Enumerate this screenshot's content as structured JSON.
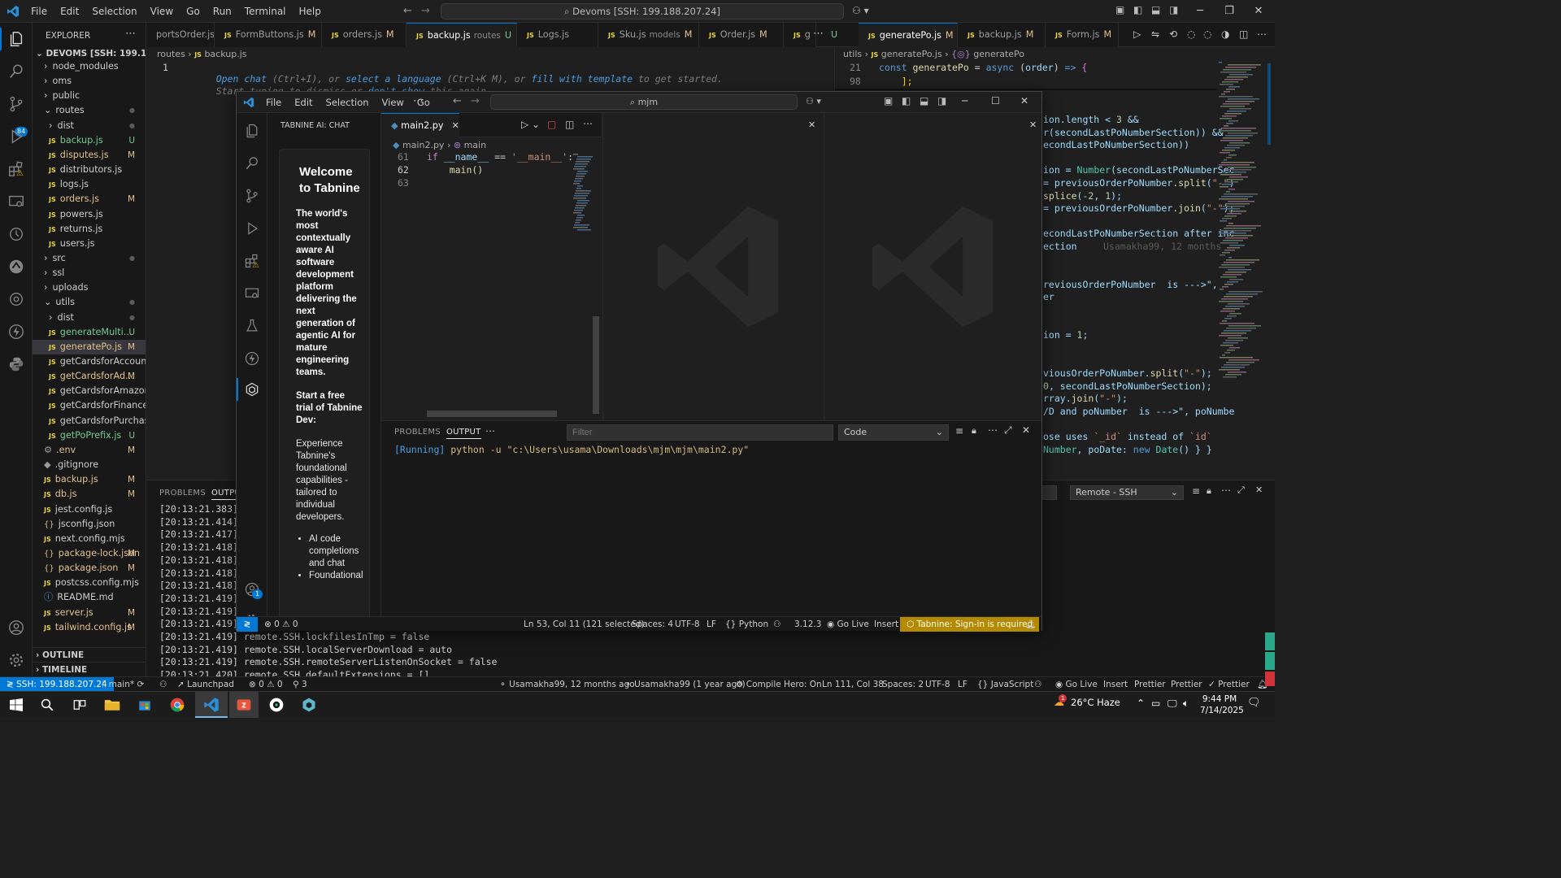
{
  "menu": [
    "File",
    "Edit",
    "Selection",
    "View",
    "Go",
    "Run",
    "Terminal",
    "Help"
  ],
  "command_center": "Devoms [SSH: 199.188.207.24]",
  "explorer": {
    "title": "EXPLORER",
    "root": "DEVOMS [SSH: 199.188.20...",
    "items": [
      {
        "name": "node_modules",
        "kind": "folder-closed",
        "depth": 1,
        "status": ""
      },
      {
        "name": "oms",
        "kind": "folder-closed",
        "depth": 1,
        "status": ""
      },
      {
        "name": "public",
        "kind": "folder-closed",
        "depth": 1,
        "status": ""
      },
      {
        "name": "routes",
        "kind": "folder-open",
        "depth": 1,
        "status": "dot"
      },
      {
        "name": "dist",
        "kind": "folder-closed",
        "depth": 2,
        "status": "dot"
      },
      {
        "name": "backup.js",
        "kind": "js",
        "depth": 2,
        "status": "U"
      },
      {
        "name": "disputes.js",
        "kind": "js",
        "depth": 2,
        "status": "M"
      },
      {
        "name": "distributors.js",
        "kind": "js",
        "depth": 2,
        "status": ""
      },
      {
        "name": "logs.js",
        "kind": "js",
        "depth": 2,
        "status": ""
      },
      {
        "name": "orders.js",
        "kind": "js",
        "depth": 2,
        "status": "M"
      },
      {
        "name": "powers.js",
        "kind": "js",
        "depth": 2,
        "status": ""
      },
      {
        "name": "returns.js",
        "kind": "js",
        "depth": 2,
        "status": ""
      },
      {
        "name": "users.js",
        "kind": "js",
        "depth": 2,
        "status": ""
      },
      {
        "name": "src",
        "kind": "folder-closed",
        "depth": 1,
        "status": "dot"
      },
      {
        "name": "ssl",
        "kind": "folder-closed",
        "depth": 1,
        "status": ""
      },
      {
        "name": "uploads",
        "kind": "folder-closed",
        "depth": 1,
        "status": ""
      },
      {
        "name": "utils",
        "kind": "folder-open",
        "depth": 1,
        "status": "dot"
      },
      {
        "name": "dist",
        "kind": "folder-closed",
        "depth": 2,
        "status": "dot"
      },
      {
        "name": "generateMulti...",
        "kind": "js",
        "depth": 2,
        "status": "U"
      },
      {
        "name": "generatePo.js",
        "kind": "js",
        "depth": 2,
        "status": "M",
        "selected": true
      },
      {
        "name": "getCardsforAccount.js",
        "kind": "js",
        "depth": 2,
        "status": ""
      },
      {
        "name": "getCardsforAd...",
        "kind": "js",
        "depth": 2,
        "status": "M"
      },
      {
        "name": "getCardsforAmazon.js",
        "kind": "js",
        "depth": 2,
        "status": ""
      },
      {
        "name": "getCardsforFinance.js",
        "kind": "js",
        "depth": 2,
        "status": ""
      },
      {
        "name": "getCardsforPurchasi...",
        "kind": "js",
        "depth": 2,
        "status": ""
      },
      {
        "name": "getPoPrefix.js",
        "kind": "js",
        "depth": 2,
        "status": "U"
      },
      {
        "name": ".env",
        "kind": "gear",
        "depth": 1,
        "status": "M"
      },
      {
        "name": ".gitignore",
        "kind": "git",
        "depth": 1,
        "status": ""
      },
      {
        "name": "backup.js",
        "kind": "js",
        "depth": 1,
        "status": "M"
      },
      {
        "name": "db.js",
        "kind": "js",
        "depth": 1,
        "status": "M"
      },
      {
        "name": "jest.config.js",
        "kind": "js",
        "depth": 1,
        "status": ""
      },
      {
        "name": "jsconfig.json",
        "kind": "json",
        "depth": 1,
        "status": ""
      },
      {
        "name": "next.config.mjs",
        "kind": "js",
        "depth": 1,
        "status": ""
      },
      {
        "name": "package-lock.json",
        "kind": "json",
        "depth": 1,
        "status": "M"
      },
      {
        "name": "package.json",
        "kind": "json",
        "depth": 1,
        "status": "M"
      },
      {
        "name": "postcss.config.mjs",
        "kind": "js",
        "depth": 1,
        "status": ""
      },
      {
        "name": "README.md",
        "kind": "info",
        "depth": 1,
        "status": ""
      },
      {
        "name": "server.js",
        "kind": "js",
        "depth": 1,
        "status": "M"
      },
      {
        "name": "tailwind.config.js",
        "kind": "js",
        "depth": 1,
        "status": "M"
      }
    ],
    "outline": "OUTLINE",
    "timeline": "TIMELINE"
  },
  "tabs_left": [
    {
      "name": "portsOrder.js",
      "mark": ""
    },
    {
      "name": "FormButtons.js",
      "mark": "M"
    },
    {
      "name": "orders.js",
      "mark": "M"
    },
    {
      "name": "backup.js",
      "desc": "routes",
      "mark": "U",
      "active": true
    },
    {
      "name": "Logs.js",
      "mark": ""
    },
    {
      "name": "Sku.js",
      "desc": "models",
      "mark": "M"
    },
    {
      "name": "Order.js",
      "mark": "M"
    },
    {
      "name": "g",
      "mark": ""
    }
  ],
  "tabs_right": [
    {
      "name": "generatePo.js",
      "mark": "M",
      "active": true
    },
    {
      "name": "backup.js",
      "mark": "M"
    },
    {
      "name": "Form.js",
      "mark": "M"
    }
  ],
  "left_editor": {
    "breadcrumb": [
      "routes",
      "backup.js"
    ],
    "line_no": "1",
    "hint1_parts": [
      "Open chat",
      " (Ctrl+I), or ",
      "select a language",
      " (Ctrl+K M), or ",
      "fill with template",
      " to get started."
    ],
    "hint2_parts": [
      "Start typing to dismiss or ",
      "don't show",
      " this again."
    ]
  },
  "right_editor": {
    "breadcrumb": [
      "utils",
      "generatePo.js",
      "generatePo"
    ],
    "sticky": [
      {
        "n": "21",
        "code": "const generatePo = async (order) => {"
      },
      {
        "n": "98",
        "code": "    ];"
      }
    ],
    "lines": [
      "ion.length < 3 &&",
      "r(secondLastPoNumberSection)) &&",
      "econdLastPoNumberSection))",
      "",
      "ion = Number(secondLastPoNumberSec",
      "= previousOrderPoNumber.split(\"-\")",
      "splice(-2, 1);",
      "= previousOrderPoNumber.join(\"-\");",
      "",
      "econdLastPoNumberSection after inc",
      "ection",
      "",
      "",
      "reviousOrderPoNumber  is --->\",",
      "er",
      "",
      "",
      "ion = 1;",
      "",
      "",
      "viousOrderPoNumber.split(\"-\");",
      "0, secondLastPoNumberSection);",
      "rray.join(\"-\");",
      "/D and poNumber  is --->\", poNumbe",
      "",
      "ose uses `_id` instead of `id`",
      "Number, poDate: new Date() } }"
    ],
    "blame": "Usamakha99, 12 months"
  },
  "bottom_panel": {
    "tabs": [
      "PROBLEMS",
      "OUTPUT"
    ],
    "channel": "Remote - SSH",
    "lines": [
      "[20:13:21.383]",
      "[20:13:21.414]",
      "[20:13:21.417]",
      "[20:13:21.418]",
      "[20:13:21.418]",
      "[20:13:21.418]",
      "[20:13:21.418]",
      "[20:13:21.419]",
      "[20:13:21.419]",
      "[20:13:21.419]",
      "[20:13:21.419] remote.SSH.lockfilesInTmp = false",
      "[20:13:21.419] remote.SSH.localServerDownload = auto",
      "[20:13:21.419] remote.SSH.remoteServerListenOnSocket = false",
      "[20:13:21.420] remote.SSH.defaultExtensions = []"
    ]
  },
  "inner_window": {
    "menu": [
      "File",
      "Edit",
      "Selection",
      "View",
      "Go"
    ],
    "search": "mjm",
    "tabnine_title": "TABNINE AI: CHAT",
    "welcome_title": "Welcome to Tabnine",
    "welcome_sub": "The world's most contextually aware AI software development platform delivering the next generation of agentic AI for mature engineering teams.",
    "trial_title": "Start a free trial of Tabnine Dev:",
    "trial_body": "Experience Tabnine's foundational capabilities - tailored to individual developers.",
    "bullets": [
      "AI code completions and chat",
      "Foundational"
    ],
    "tab": "main2.py",
    "breadcrumb": [
      "main2.py",
      "main"
    ],
    "code": [
      {
        "n": "61",
        "code": "if __name__ == '__main__':"
      },
      {
        "n": "62",
        "code": "    main()"
      },
      {
        "n": "63",
        "code": ""
      }
    ],
    "panel_tabs": [
      "PROBLEMS",
      "OUTPUT"
    ],
    "filter_placeholder": "Filter",
    "channel": "Code",
    "output_running": "[Running]",
    "output_cmd": " python -u \"c:\\Users\\usama\\Downloads\\mjm\\mjm\\main2.py\"",
    "status": {
      "errors": "0",
      "warnings": "0",
      "position": "Ln 53, Col 11 (121 selected)",
      "spaces": "Spaces: 4",
      "encoding": "UTF-8",
      "eol": "LF",
      "language": "Python",
      "version": "3.12.3",
      "golive": "Go Live",
      "insert": "Insert",
      "tabnine": "Tabnine: Sign-in is required"
    }
  },
  "statusbar": {
    "remote": "SSH: 199.188.207.24",
    "branch": "main*",
    "errors": "0",
    "warnings": "0",
    "launchpad": "Launchpad",
    "ports": "3",
    "blame1": "Usamakha99, 12 months ago",
    "blame2": "Usamakha99 (1 year ago)",
    "compile": "Compile Hero: On",
    "position": "Ln 111, Col 38",
    "spaces": "Spaces: 2",
    "encoding": "UTF-8",
    "eol": "LF",
    "language": "JavaScript",
    "golive": "Go Live",
    "insert": "Insert",
    "prettier1": "Prettier",
    "prettier2": "Prettier",
    "prettier3": "Prettier"
  },
  "taskbar": {
    "weather": "26°C Haze",
    "time": "9:44 PM",
    "date": "7/14/2025",
    "weather_badge": "1"
  },
  "badges": {
    "scm": "84",
    "account": "1"
  },
  "colors": {
    "accent": "#0078d4",
    "modified": "#e2c08d",
    "untracked": "#73c991",
    "tabnine_warn": "#b38a00",
    "remote": "#0078d4"
  }
}
